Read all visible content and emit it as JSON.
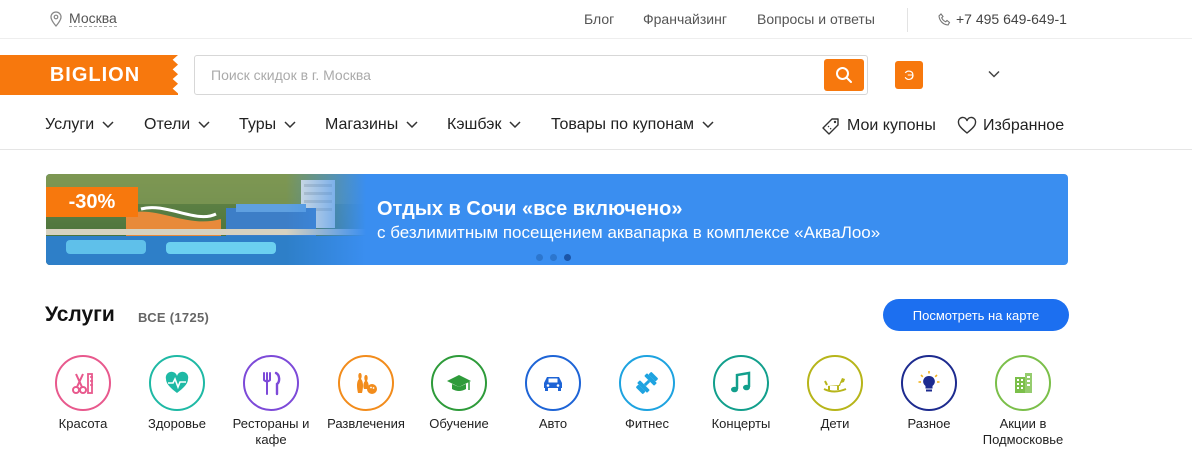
{
  "topbar": {
    "city": "Москва",
    "links": [
      "Блог",
      "Франчайзинг",
      "Вопросы и ответы"
    ],
    "phone": "+7 495 649-649-1"
  },
  "header": {
    "logo": "BIGLION",
    "search_placeholder": "Поиск скидок в г. Москва",
    "user_initial": "Э"
  },
  "nav": {
    "items": [
      "Услуги",
      "Отели",
      "Туры",
      "Магазины",
      "Кэшбэк",
      "Товары по купонам"
    ],
    "coupons": "Мои купоны",
    "favorites": "Избранное"
  },
  "banner": {
    "discount": "-30%",
    "title": "Отдых в Сочи «все включено»",
    "subtitle": "с безлимитным посещением аквапарка в комплексе «АкваЛоо»"
  },
  "services": {
    "title": "Услуги",
    "count": "ВСЕ (1725)",
    "map_button": "Посмотреть на карте",
    "categories": [
      {
        "label": "Красота",
        "color": "#e8598d",
        "icon": "scissors-comb-icon"
      },
      {
        "label": "Здоровье",
        "color": "#1fb9a5",
        "icon": "heart-pulse-icon"
      },
      {
        "label": "Рестораны и кафе",
        "color": "#7d4ad8",
        "icon": "fork-knife-icon"
      },
      {
        "label": "Развлечения",
        "color": "#f28c1c",
        "icon": "bowling-icon"
      },
      {
        "label": "Обучение",
        "color": "#2e9b3a",
        "icon": "graduation-cap-icon"
      },
      {
        "label": "Авто",
        "color": "#1e64d6",
        "icon": "car-icon"
      },
      {
        "label": "Фитнес",
        "color": "#1ea3e0",
        "icon": "dumbbell-icon"
      },
      {
        "label": "Концерты",
        "color": "#129f8c",
        "icon": "music-note-icon"
      },
      {
        "label": "Дети",
        "color": "#b7b51a",
        "icon": "rocking-horse-icon"
      },
      {
        "label": "Разное",
        "color": "#1d2b8f",
        "icon": "light-bulb-icon"
      },
      {
        "label": "Акции в Подмосковье",
        "color": "#7bbf4a",
        "icon": "building-icon"
      }
    ]
  }
}
